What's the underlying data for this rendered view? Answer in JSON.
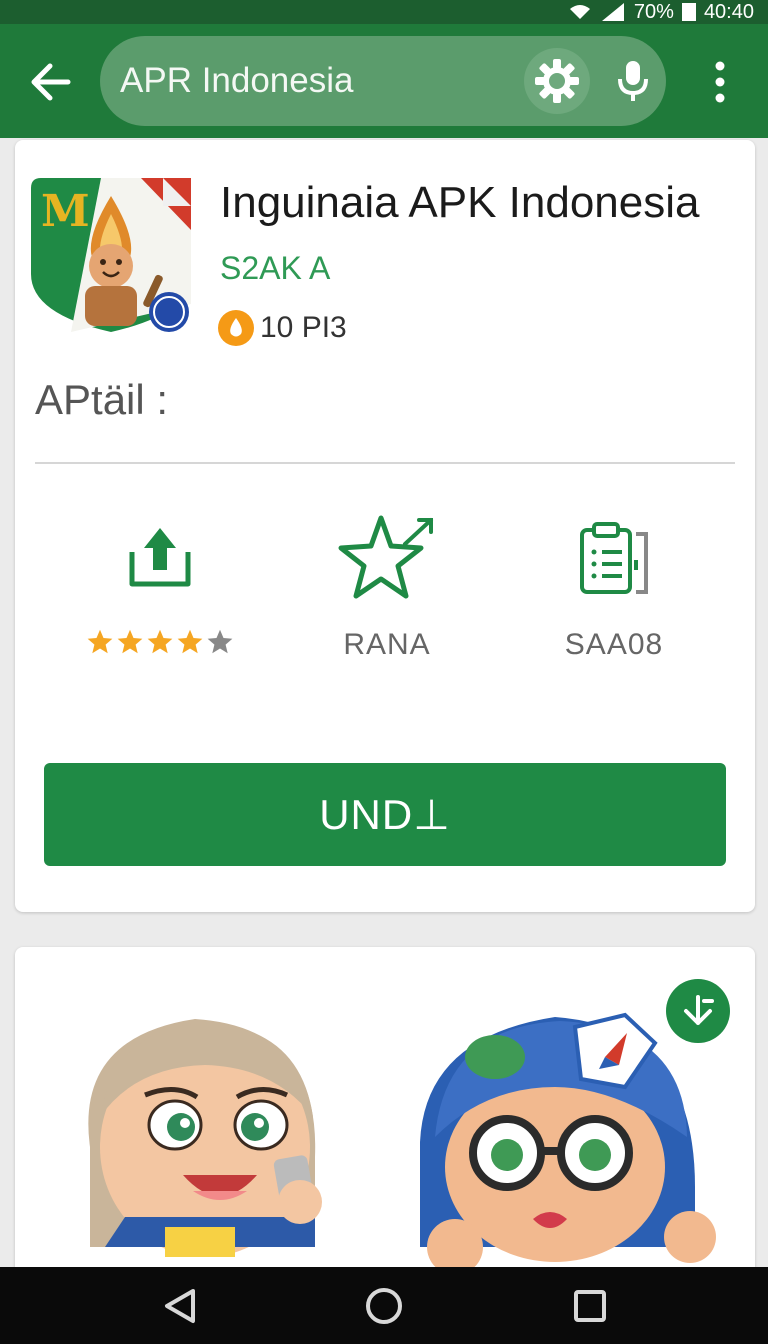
{
  "status_bar": {
    "battery": "70%",
    "time": "40:40"
  },
  "app_bar": {
    "search_text": "APR Indonesia",
    "icons": [
      "back-arrow-icon",
      "gear-icon",
      "mic-icon",
      "more-vert-icon"
    ]
  },
  "app": {
    "title": "Inguinaia APK Indonesia",
    "developer": "S2AK A",
    "coin_text": "10 PI3",
    "detail_label": "APtäil :",
    "icon_text": "M"
  },
  "stats": [
    {
      "icon": "download-icon",
      "label": "",
      "rating": 4,
      "rating_max": 5
    },
    {
      "icon": "star-icon",
      "label": "RANA"
    },
    {
      "icon": "clipboard-icon",
      "label": "SAA08"
    }
  ],
  "install_button": {
    "label": "UND⊥"
  },
  "colors": {
    "app_bar": "#1f7a3a",
    "status_bar": "#1c5e2f",
    "accent": "#1f8a45",
    "developer": "#2f9a55",
    "star": "#f5a623"
  }
}
